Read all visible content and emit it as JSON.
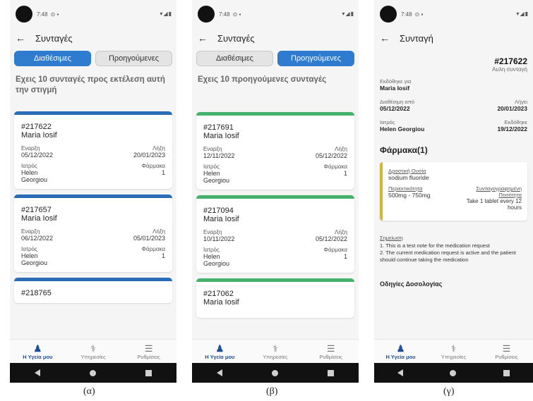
{
  "status": {
    "time": "7:48",
    "icons_left": "⊙ ▪",
    "icons_right": "▾◢▮"
  },
  "screen_a": {
    "title": "Συνταγές",
    "tab_available": "Διαθέσιμες",
    "tab_previous": "Προηγούμενες",
    "summary": "Εχεις 10 συνταγές προς εκτέλεση αυτή την στιγμή",
    "cards": [
      {
        "id": "#217622",
        "name": "Maria Iosif",
        "start_label": "Εναρξη",
        "start": "05/12/2022",
        "end_label": "Λήξη",
        "end": "20/01/2023",
        "doctor_label": "Ιατρός",
        "doctor": "Helen Georgiou",
        "drugs_label": "Φάρμακα",
        "drugs": "1"
      },
      {
        "id": "#217657",
        "name": "Maria Iosif",
        "start_label": "Εναρξη",
        "start": "06/12/2022",
        "end_label": "Λήξη",
        "end": "05/01/2023",
        "doctor_label": "Ιατρός",
        "doctor": "Helen Georgiou",
        "drugs_label": "Φάρμακα",
        "drugs": "1"
      }
    ],
    "partial_id": "#218765"
  },
  "screen_b": {
    "title": "Συνταγές",
    "tab_available": "Διαθέσιμες",
    "tab_previous": "Προηγούμενες",
    "summary": "Εχεις 10 προηγούμενες συνταγές",
    "cards": [
      {
        "id": "#217691",
        "name": "Maria Iosif",
        "start_label": "Εναρξη",
        "start": "12/11/2022",
        "end_label": "Λήξη",
        "end": "05/12/2022",
        "doctor_label": "Ιατρός",
        "doctor": "Helen Georgiou",
        "drugs_label": "Φάρμακα",
        "drugs": "1"
      },
      {
        "id": "#217094",
        "name": "Maria Iosif",
        "start_label": "Εναρξη",
        "start": "10/11/2022",
        "end_label": "Λήξη",
        "end": "05/12/2022",
        "doctor_label": "Ιατρός",
        "doctor": "Helen Georgiou",
        "drugs_label": "Φάρμακα",
        "drugs": "1"
      }
    ],
    "partial_id": "#217062",
    "partial_name": "Maria Iosif"
  },
  "screen_c": {
    "title": "Συνταγή",
    "id": "#217622",
    "subtitle": "Αυλη συνταγή",
    "issued_for_label": "Εκδόθηκε για",
    "issued_for": "Maria Iosif",
    "available_from_label": "Διαθέσιμη από",
    "available_from": "05/12/2022",
    "expires_label": "Λήγει",
    "expires": "20/01/2023",
    "doctor_label": "Ιατρός",
    "doctor": "Helen Georgiou",
    "issued_label": "Εκδόθηκε",
    "issued": "19/12/2022",
    "meds_title": "Φάρμακα(1)",
    "substance_label": "Δραστική Ουσία",
    "substance": "sodium fluoride",
    "content_label": "Περιεκτικότητα",
    "content": "500mg - 750mg",
    "dosage_label": "Συνταγογραφημένη Ποσότητα",
    "dosage": "Take 1 tablet every 12 hours",
    "notes_label": "Σημείωση",
    "note1": "1. This is a test note for the medication request",
    "note2": "2. The current medication request is active and the patient should continue taking the medication",
    "dosage_instructions": "Οδηγίες Δοσολογίας"
  },
  "nav": {
    "health": "Η Υγεία μου",
    "services": "Υπηρεσίες",
    "settings": "Ρυθμίσεις"
  },
  "captions": {
    "a": "(α)",
    "b": "(β)",
    "c": "(γ)"
  }
}
